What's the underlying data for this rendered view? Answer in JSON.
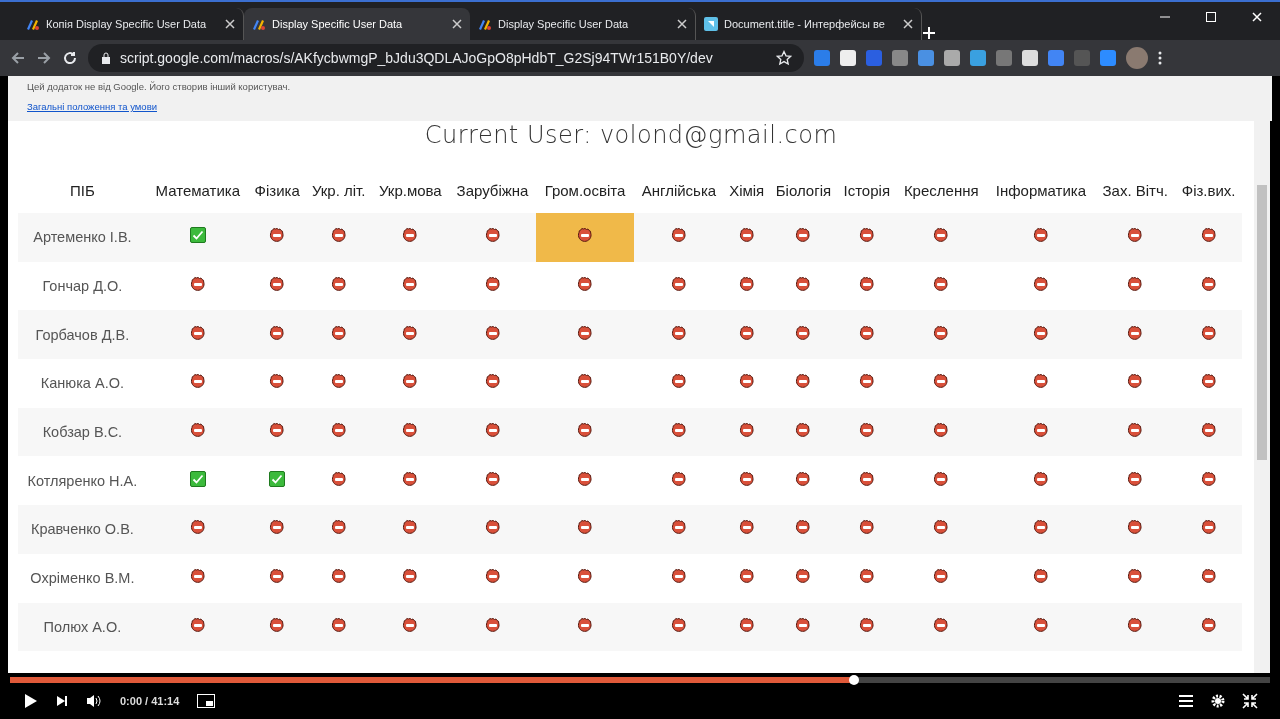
{
  "browser": {
    "tabs": [
      {
        "title": "Копія Display Specific User Data",
        "selected": false
      },
      {
        "title": "Display Specific User Data",
        "selected": true
      },
      {
        "title": "Display Specific User Data",
        "selected": false
      },
      {
        "title": "Document.title - Интерфейсы ве",
        "selected": false
      }
    ],
    "url": "script.google.com/macros/s/AKfycbwmgP_bJdu3QDLAJoGpO8pHdbT_G2Sj94TWr151B0Y/dev"
  },
  "notice": {
    "text": "Цей додаток не від Google. Його створив інший користувач.",
    "link": "Загальні положення та умови"
  },
  "heading": "Current User: volond@gmail.com",
  "table": {
    "columns": [
      "ПІБ",
      "Математика",
      "Фізика",
      "Укр. літ.",
      "Укр.мова",
      "Зарубіжна",
      "Гром.освіта",
      "Англійська",
      "Хімія",
      "Біологія",
      "Історія",
      "Креслення",
      "Інформатика",
      "Зах. Вітч.",
      "Фіз.вих."
    ],
    "rows": [
      {
        "name": "Артеменко І.В.",
        "cells": [
          {
            "passed": true,
            "selected": false
          },
          {
            "passed": false,
            "selected": false
          },
          {
            "passed": false,
            "selected": false
          },
          {
            "passed": false,
            "selected": false
          },
          {
            "passed": false,
            "selected": false
          },
          {
            "passed": false,
            "selected": true
          },
          {
            "passed": false,
            "selected": false
          },
          {
            "passed": false,
            "selected": false
          },
          {
            "passed": false,
            "selected": false
          },
          {
            "passed": false,
            "selected": false
          },
          {
            "passed": false,
            "selected": false
          },
          {
            "passed": false,
            "selected": false
          },
          {
            "passed": false,
            "selected": false
          },
          {
            "passed": false,
            "selected": false
          }
        ]
      },
      {
        "name": "Гончар Д.О.",
        "cells": [
          {
            "passed": false,
            "selected": false
          },
          {
            "passed": false,
            "selected": false
          },
          {
            "passed": false,
            "selected": false
          },
          {
            "passed": false,
            "selected": false
          },
          {
            "passed": false,
            "selected": false
          },
          {
            "passed": false,
            "selected": false
          },
          {
            "passed": false,
            "selected": false
          },
          {
            "passed": false,
            "selected": false
          },
          {
            "passed": false,
            "selected": false
          },
          {
            "passed": false,
            "selected": false
          },
          {
            "passed": false,
            "selected": false
          },
          {
            "passed": false,
            "selected": false
          },
          {
            "passed": false,
            "selected": false
          },
          {
            "passed": false,
            "selected": false
          }
        ]
      },
      {
        "name": "Горбачов Д.В.",
        "cells": [
          {
            "passed": false,
            "selected": false
          },
          {
            "passed": false,
            "selected": false
          },
          {
            "passed": false,
            "selected": false
          },
          {
            "passed": false,
            "selected": false
          },
          {
            "passed": false,
            "selected": false
          },
          {
            "passed": false,
            "selected": false
          },
          {
            "passed": false,
            "selected": false
          },
          {
            "passed": false,
            "selected": false
          },
          {
            "passed": false,
            "selected": false
          },
          {
            "passed": false,
            "selected": false
          },
          {
            "passed": false,
            "selected": false
          },
          {
            "passed": false,
            "selected": false
          },
          {
            "passed": false,
            "selected": false
          },
          {
            "passed": false,
            "selected": false
          }
        ]
      },
      {
        "name": "Канюка А.О.",
        "cells": [
          {
            "passed": false,
            "selected": false
          },
          {
            "passed": false,
            "selected": false
          },
          {
            "passed": false,
            "selected": false
          },
          {
            "passed": false,
            "selected": false
          },
          {
            "passed": false,
            "selected": false
          },
          {
            "passed": false,
            "selected": false
          },
          {
            "passed": false,
            "selected": false
          },
          {
            "passed": false,
            "selected": false
          },
          {
            "passed": false,
            "selected": false
          },
          {
            "passed": false,
            "selected": false
          },
          {
            "passed": false,
            "selected": false
          },
          {
            "passed": false,
            "selected": false
          },
          {
            "passed": false,
            "selected": false
          },
          {
            "passed": false,
            "selected": false
          }
        ]
      },
      {
        "name": "Кобзар В.С.",
        "cells": [
          {
            "passed": false,
            "selected": false
          },
          {
            "passed": false,
            "selected": false
          },
          {
            "passed": false,
            "selected": false
          },
          {
            "passed": false,
            "selected": false
          },
          {
            "passed": false,
            "selected": false
          },
          {
            "passed": false,
            "selected": false
          },
          {
            "passed": false,
            "selected": false
          },
          {
            "passed": false,
            "selected": false
          },
          {
            "passed": false,
            "selected": false
          },
          {
            "passed": false,
            "selected": false
          },
          {
            "passed": false,
            "selected": false
          },
          {
            "passed": false,
            "selected": false
          },
          {
            "passed": false,
            "selected": false
          },
          {
            "passed": false,
            "selected": false
          }
        ]
      },
      {
        "name": "Котляренко Н.А.",
        "cells": [
          {
            "passed": true,
            "selected": false
          },
          {
            "passed": true,
            "selected": false
          },
          {
            "passed": false,
            "selected": false
          },
          {
            "passed": false,
            "selected": false
          },
          {
            "passed": false,
            "selected": false
          },
          {
            "passed": false,
            "selected": false
          },
          {
            "passed": false,
            "selected": false
          },
          {
            "passed": false,
            "selected": false
          },
          {
            "passed": false,
            "selected": false
          },
          {
            "passed": false,
            "selected": false
          },
          {
            "passed": false,
            "selected": false
          },
          {
            "passed": false,
            "selected": false
          },
          {
            "passed": false,
            "selected": false
          },
          {
            "passed": false,
            "selected": false
          }
        ]
      },
      {
        "name": "Кравченко О.В.",
        "cells": [
          {
            "passed": false,
            "selected": false
          },
          {
            "passed": false,
            "selected": false
          },
          {
            "passed": false,
            "selected": false
          },
          {
            "passed": false,
            "selected": false
          },
          {
            "passed": false,
            "selected": false
          },
          {
            "passed": false,
            "selected": false
          },
          {
            "passed": false,
            "selected": false
          },
          {
            "passed": false,
            "selected": false
          },
          {
            "passed": false,
            "selected": false
          },
          {
            "passed": false,
            "selected": false
          },
          {
            "passed": false,
            "selected": false
          },
          {
            "passed": false,
            "selected": false
          },
          {
            "passed": false,
            "selected": false
          },
          {
            "passed": false,
            "selected": false
          }
        ]
      },
      {
        "name": "Охріменко В.М.",
        "cells": [
          {
            "passed": false,
            "selected": false
          },
          {
            "passed": false,
            "selected": false
          },
          {
            "passed": false,
            "selected": false
          },
          {
            "passed": false,
            "selected": false
          },
          {
            "passed": false,
            "selected": false
          },
          {
            "passed": false,
            "selected": false
          },
          {
            "passed": false,
            "selected": false
          },
          {
            "passed": false,
            "selected": false
          },
          {
            "passed": false,
            "selected": false
          },
          {
            "passed": false,
            "selected": false
          },
          {
            "passed": false,
            "selected": false
          },
          {
            "passed": false,
            "selected": false
          },
          {
            "passed": false,
            "selected": false
          },
          {
            "passed": false,
            "selected": false
          }
        ]
      },
      {
        "name": "Полюх А.О.",
        "cells": [
          {
            "passed": false,
            "selected": false
          },
          {
            "passed": false,
            "selected": false
          },
          {
            "passed": false,
            "selected": false
          },
          {
            "passed": false,
            "selected": false
          },
          {
            "passed": false,
            "selected": false
          },
          {
            "passed": false,
            "selected": false
          },
          {
            "passed": false,
            "selected": false
          },
          {
            "passed": false,
            "selected": false
          },
          {
            "passed": false,
            "selected": false
          },
          {
            "passed": false,
            "selected": false
          },
          {
            "passed": false,
            "selected": false
          },
          {
            "passed": false,
            "selected": false
          },
          {
            "passed": false,
            "selected": false
          },
          {
            "passed": false,
            "selected": false
          }
        ]
      }
    ]
  },
  "player": {
    "level": 0.67,
    "time": "0:00 / 41:14"
  }
}
